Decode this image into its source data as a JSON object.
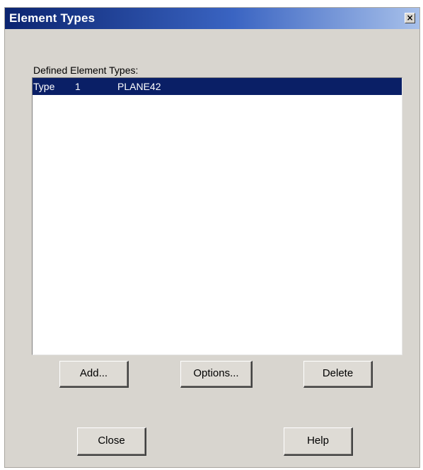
{
  "window": {
    "title": "Element Types",
    "close_glyph": "×"
  },
  "list": {
    "label": "Defined Element Types:",
    "items": [
      {
        "type_label": "Type",
        "number": "1",
        "name": "PLANE42",
        "selected": true
      }
    ]
  },
  "buttons": {
    "add": "Add...",
    "options": "Options...",
    "delete": "Delete",
    "close": "Close",
    "help": "Help"
  },
  "colors": {
    "title_bar_start": "#0b2470",
    "title_bar_end": "#a7c0ea",
    "selection": "#0a1f66",
    "dialog_bg": "#d8d5cf"
  }
}
